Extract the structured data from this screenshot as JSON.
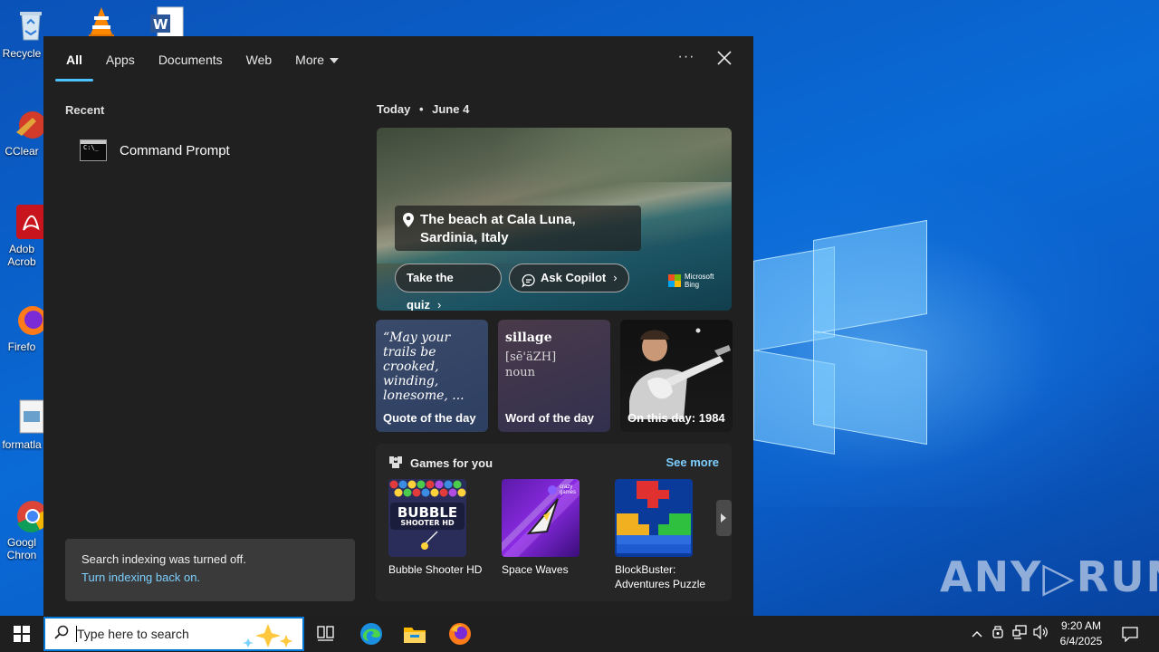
{
  "desktop": {
    "icons": [
      {
        "label": "Recycle",
        "icon": "recycle-bin-icon"
      },
      {
        "label": "CClear",
        "icon": "ccleaner-icon"
      },
      {
        "label": "Adob",
        "label2": "Acrob",
        "icon": "adobe-acrobat-icon"
      },
      {
        "label": "Firefo",
        "icon": "firefox-icon"
      },
      {
        "label": "formatla",
        "icon": "image-file-icon"
      },
      {
        "label": "Googl",
        "label2": "Chron",
        "icon": "chrome-icon"
      }
    ],
    "top_icons": [
      "vlc-icon",
      "word-icon"
    ],
    "watermark": "ANY▷RUN"
  },
  "search_panel": {
    "tabs": [
      {
        "label": "All",
        "active": true
      },
      {
        "label": "Apps"
      },
      {
        "label": "Documents"
      },
      {
        "label": "Web"
      },
      {
        "label": "More"
      }
    ],
    "more_icon": "ellipsis-icon",
    "close_icon": "close-icon",
    "recent": {
      "title": "Recent",
      "items": [
        {
          "label": "Command Prompt",
          "icon": "command-prompt-icon",
          "icon_text": "C:\\_"
        }
      ]
    },
    "indexing": {
      "message": "Search indexing was turned off.",
      "link": "Turn indexing back on."
    },
    "today": {
      "label": "Today",
      "separator": "•",
      "date": "June 4"
    },
    "hero": {
      "caption": "The beach at Cala Luna, Sardinia, Italy",
      "quiz_button": "Take the quiz",
      "copilot_button": "Ask Copilot",
      "bing_line1": "Microsoft",
      "bing_line2": "Bing"
    },
    "cards": {
      "quote": {
        "text": "“May your trails be crooked, winding, lonesome, ...",
        "label": "Quote of the day"
      },
      "word": {
        "word": "sillage",
        "pronunciation": "[sē'äZH]",
        "pos": "noun",
        "label": "Word of the day"
      },
      "history": {
        "label": "On this day: 1984"
      }
    },
    "games": {
      "title": "Games for you",
      "see_more": "See more",
      "items": [
        {
          "label": "Bubble Shooter HD",
          "thumb_text1": "BUBBLE",
          "thumb_text2": "SHOOTER HD"
        },
        {
          "label": "Space Waves",
          "thumb_text1": "crazy",
          "thumb_text2": "games"
        },
        {
          "label": "BlockBuster: Adventures Puzzle"
        }
      ]
    }
  },
  "taskbar": {
    "search_placeholder": "Type here to search",
    "apps": [
      "task-view-icon",
      "edge-icon",
      "file-explorer-icon",
      "firefox-icon"
    ],
    "time": "9:20 AM",
    "date": "6/4/2025"
  },
  "colors": {
    "accent": "#4cc2ff",
    "link": "#7ccfff",
    "panel_bg": "#202020",
    "taskbar_bg": "#1f1f1f"
  }
}
